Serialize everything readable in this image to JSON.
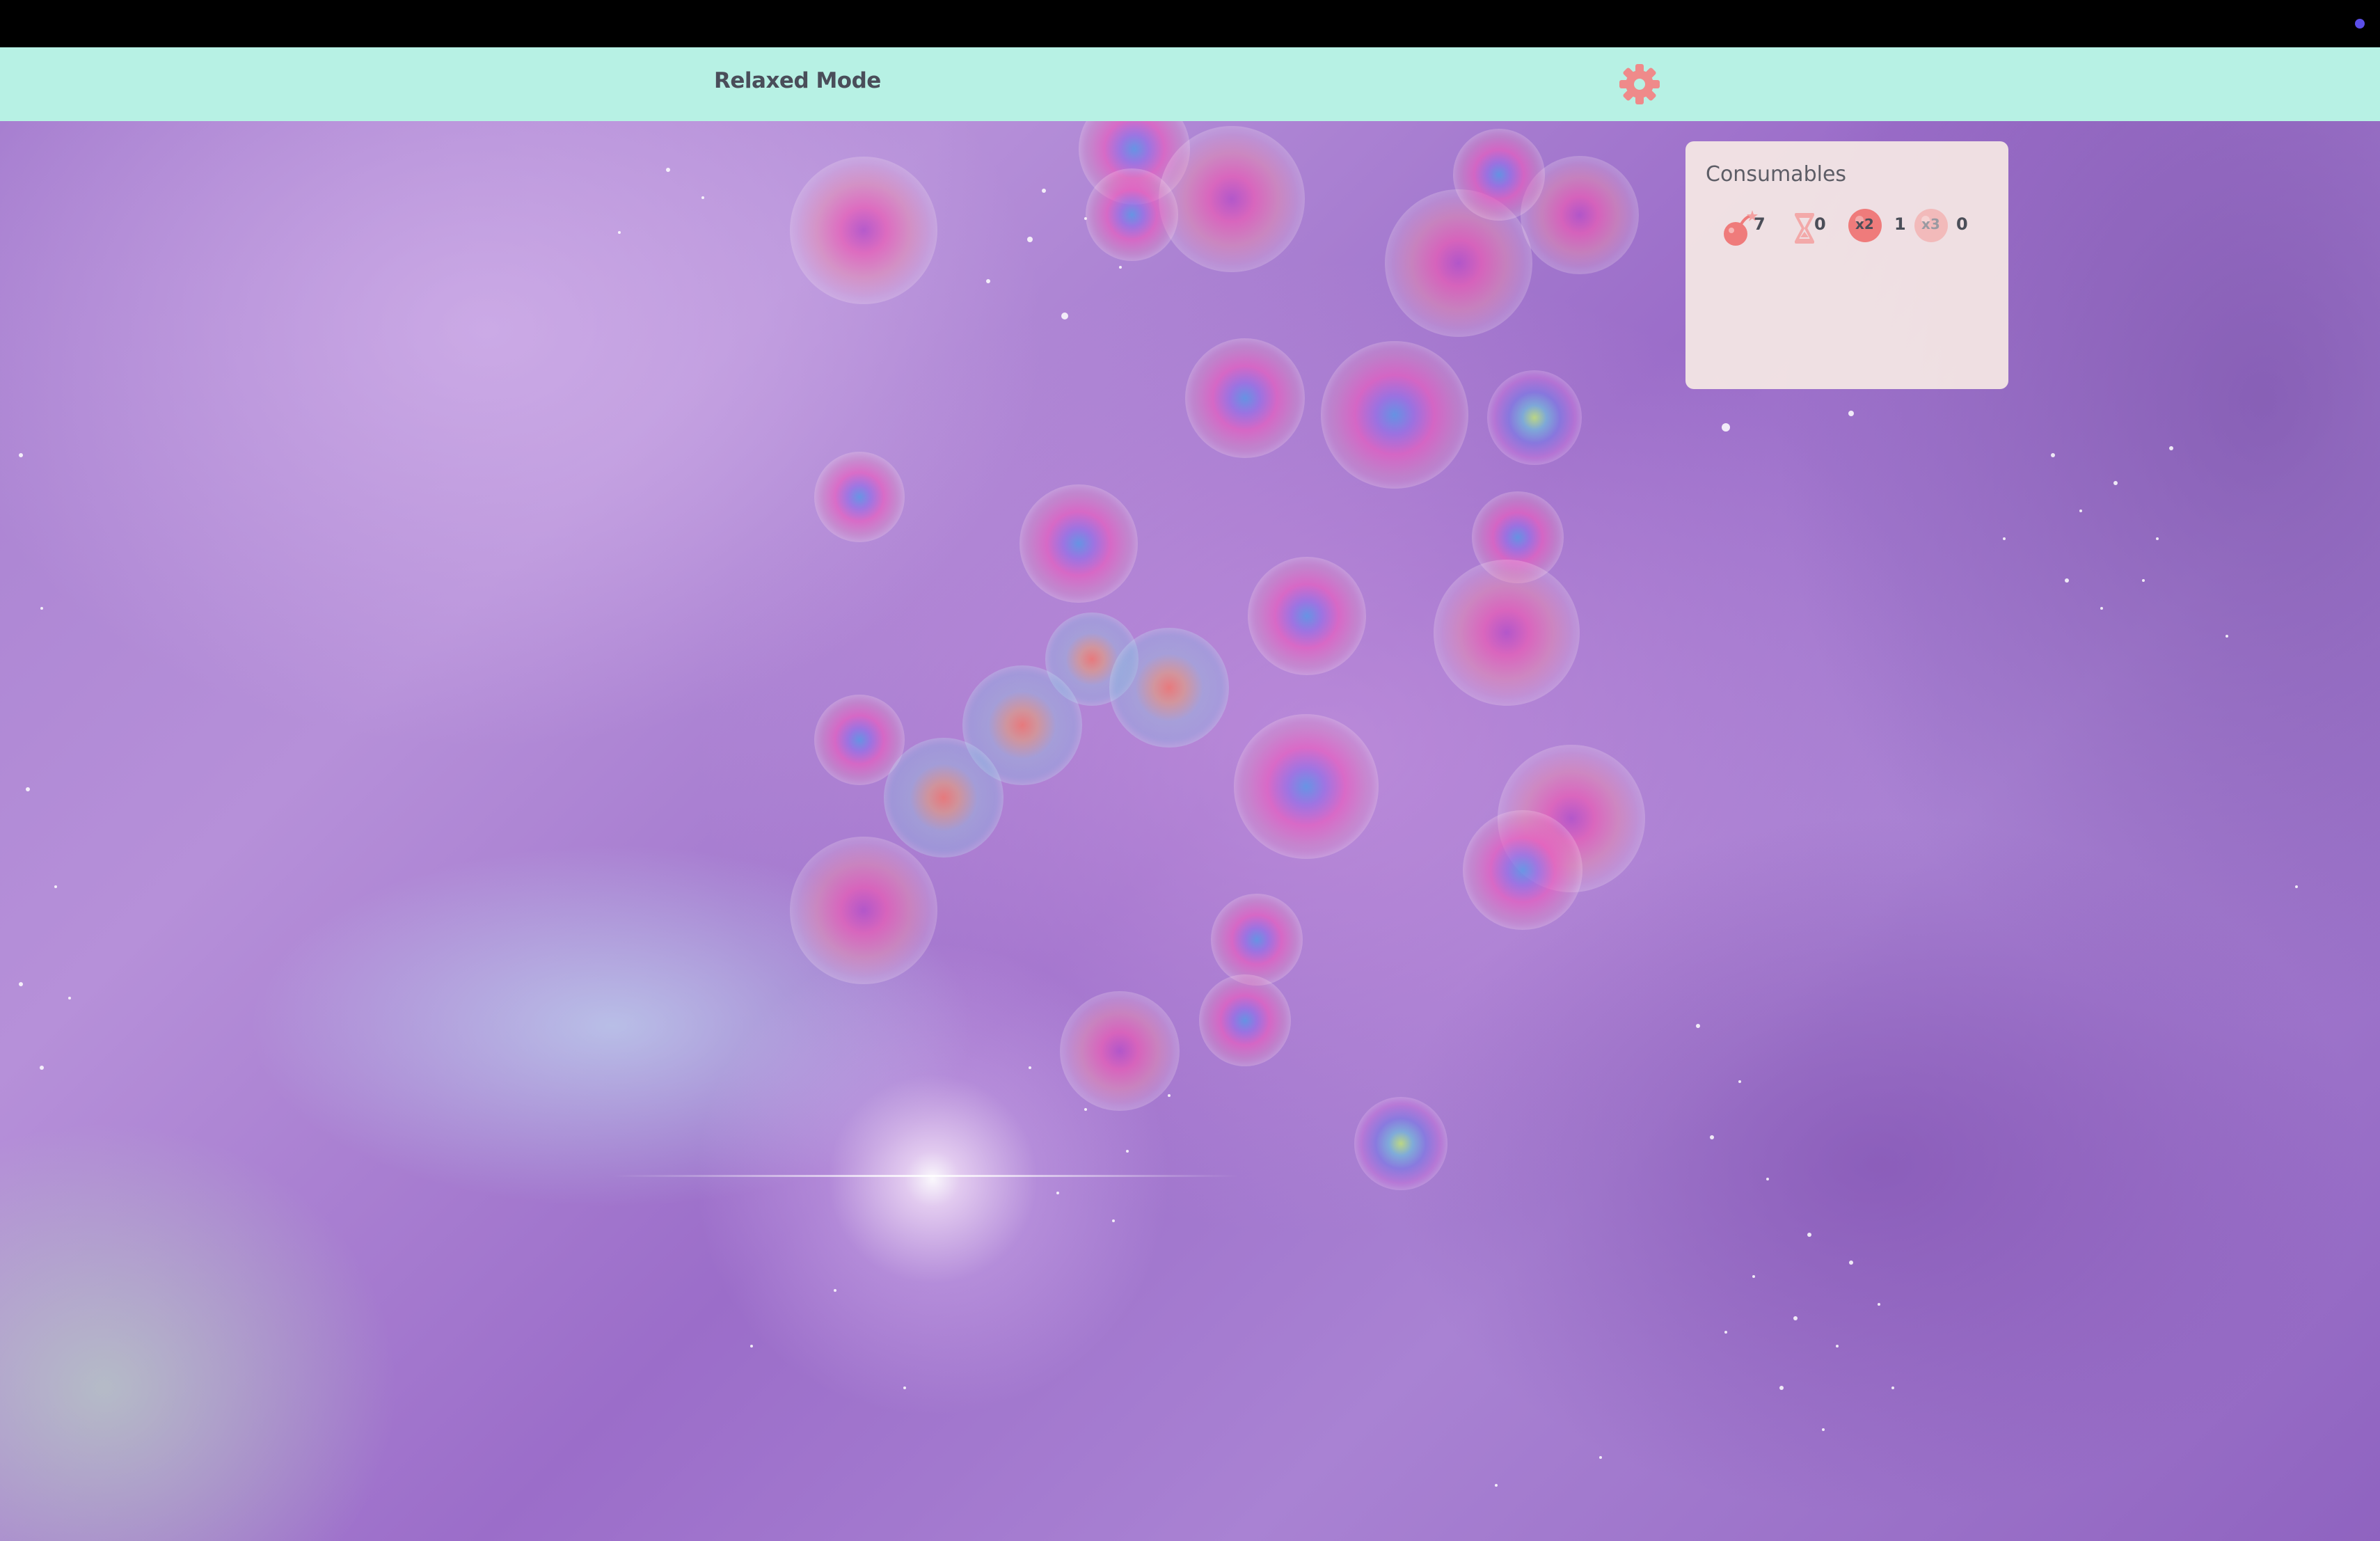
{
  "header": {
    "mode_title": "Relaxed Mode",
    "settings_icon": "gear-icon",
    "accent_color": "#b7f1e4",
    "gear_color": "#ef8a8a"
  },
  "consumables": {
    "title": "Consumables",
    "items": [
      {
        "name": "bomb",
        "icon": "bomb-icon",
        "count": "7"
      },
      {
        "name": "time",
        "icon": "hourglass-icon",
        "count": "0"
      },
      {
        "name": "double",
        "icon": "multiplier-x2-icon",
        "label": "x2",
        "count": "1"
      },
      {
        "name": "triple",
        "icon": "multiplier-x3-icon",
        "label": "x3",
        "count": "0"
      }
    ]
  }
}
